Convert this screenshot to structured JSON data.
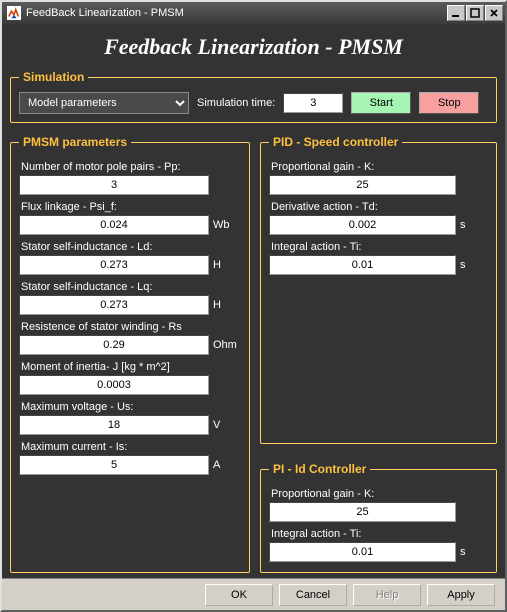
{
  "window": {
    "title": "FeedBack Linearization - PMSM"
  },
  "app_title": "Feedback Linearization - PMSM",
  "simulation": {
    "legend": "Simulation",
    "dropdown_value": "Model parameters",
    "time_label": "Simulation time:",
    "time_value": "3",
    "start_label": "Start",
    "stop_label": "Stop"
  },
  "pmsm": {
    "legend": "PMSM parameters",
    "pp_label": "Number of motor pole pairs - Pp:",
    "pp_value": "3",
    "psif_label": "Flux linkage - Psi_f:",
    "psif_value": "0.024",
    "psif_unit": "Wb",
    "ld_label": "Stator self-inductance - Ld:",
    "ld_value": "0.273",
    "ld_unit": "H",
    "lq_label": "Stator self-inductance - Lq:",
    "lq_value": "0.273",
    "lq_unit": "H",
    "rs_label": "Resistence of stator winding - Rs",
    "rs_value": "0.29",
    "rs_unit": "Ohm",
    "j_label": "Moment of inertia- J [kg * m^2]",
    "j_value": "0.0003",
    "us_label": "Maximum voltage - Us:",
    "us_value": "18",
    "us_unit": "V",
    "is_label": "Maximum current - Is:",
    "is_value": "5",
    "is_unit": "A"
  },
  "pid": {
    "legend": "PID - Speed controller",
    "k_label": "Proportional gain - K:",
    "k_value": "25",
    "td_label": "Derivative action - Td:",
    "td_value": "0.002",
    "td_unit": "s",
    "ti_label": "Integral action - Ti:",
    "ti_value": "0.01",
    "ti_unit": "s"
  },
  "pi": {
    "legend": "PI - Id Controller",
    "k_label": "Proportional gain - K:",
    "k_value": "25",
    "ti_label": "Integral action - Ti:",
    "ti_value": "0.01",
    "ti_unit": "s"
  },
  "bottom": {
    "ok": "OK",
    "cancel": "Cancel",
    "help": "Help",
    "apply": "Apply"
  }
}
